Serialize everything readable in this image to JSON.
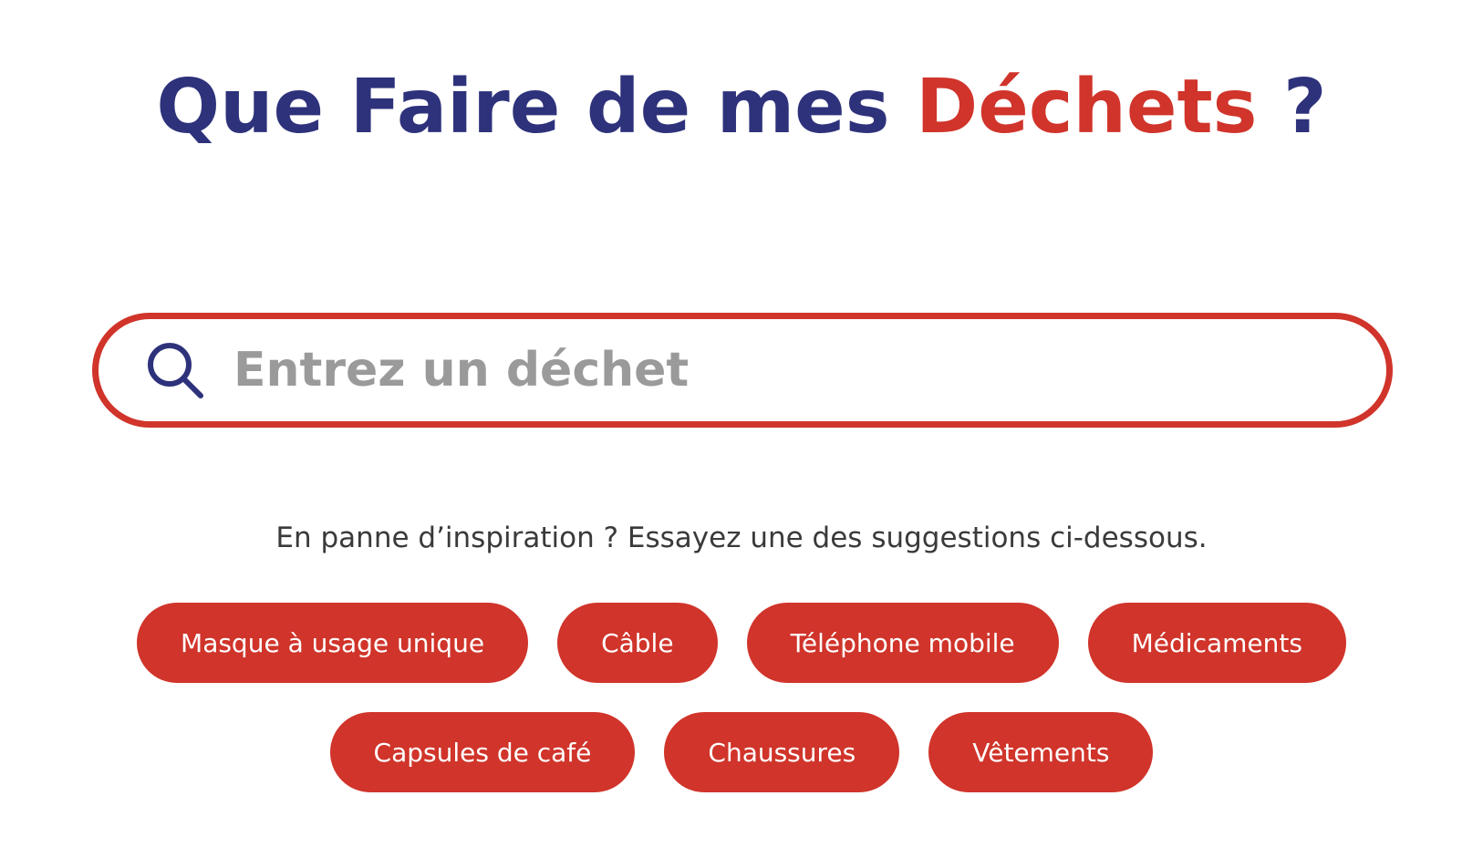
{
  "header": {
    "title_main": "Que Faire de mes",
    "title_accent": "Déchets",
    "title_end": "?"
  },
  "search": {
    "placeholder": "Entrez un déchet",
    "value": "",
    "icon": "search-icon"
  },
  "hint": {
    "text": "En panne d’inspiration ? Essayez une des suggestions ci-dessous."
  },
  "suggestions": {
    "row1": [
      "Masque à usage unique",
      "Câble",
      "Téléphone mobile",
      "Médicaments"
    ],
    "row2": [
      "Capsules de café",
      "Chaussures",
      "Vêtements"
    ]
  },
  "colors": {
    "primary": "#2e327b",
    "accent": "#d0342a",
    "placeholder": "#9a9a9a",
    "text": "#3a3a3a"
  }
}
